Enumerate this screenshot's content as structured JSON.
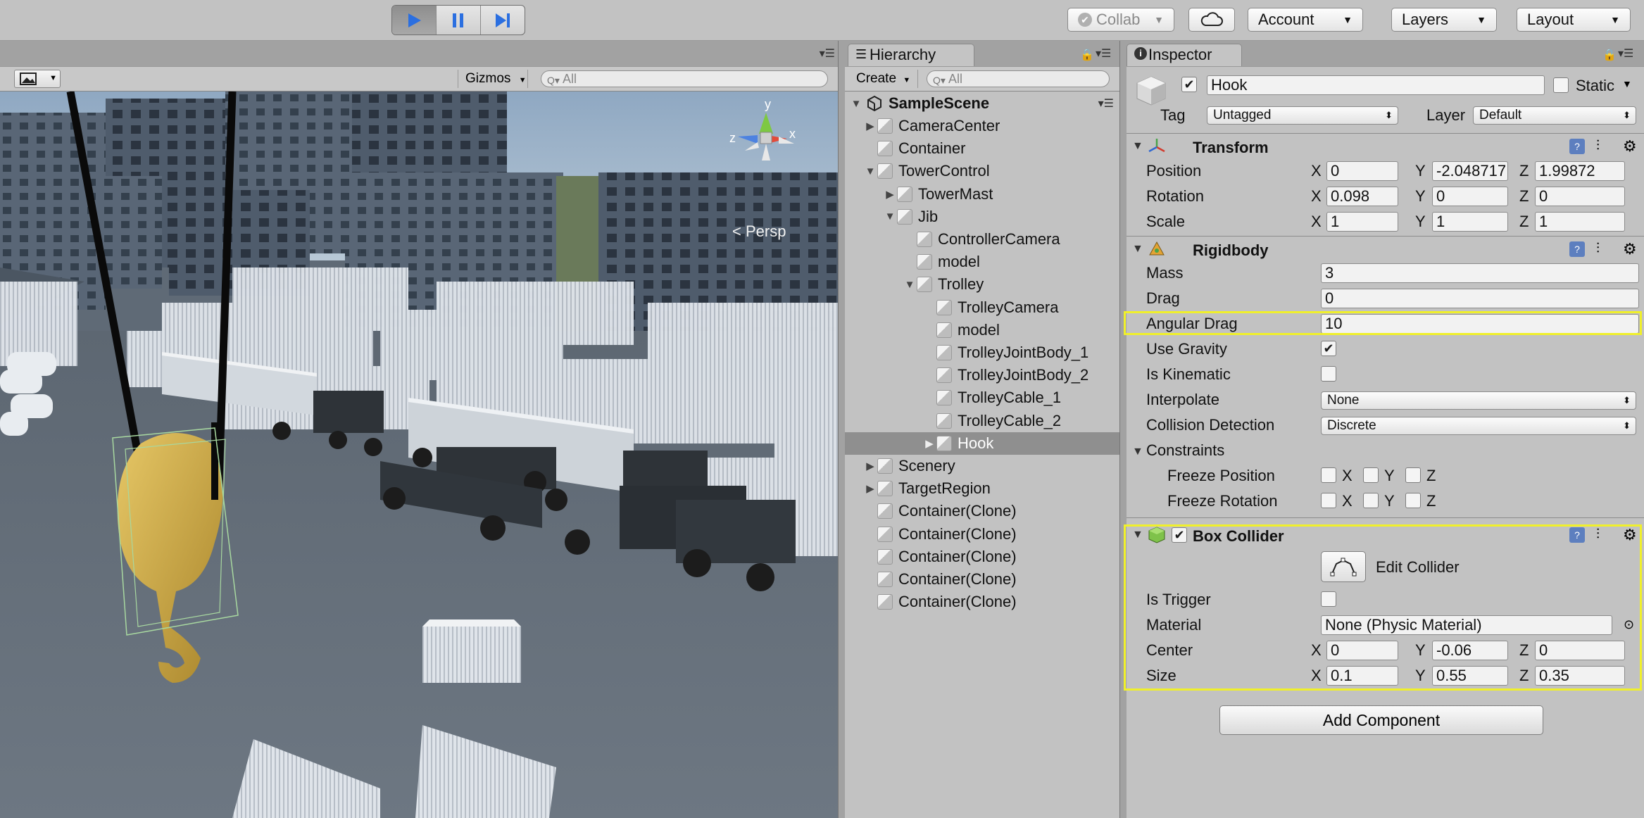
{
  "toolbar": {
    "collab_label": "Collab",
    "account_label": "Account",
    "layers_label": "Layers",
    "layout_label": "Layout"
  },
  "scene": {
    "gizmos_label": "Gizmos",
    "search_placeholder": "All",
    "persp_label": "Persp",
    "axis_x": "x",
    "axis_y": "y",
    "axis_z": "z"
  },
  "hierarchy": {
    "tab_label": "Hierarchy",
    "create_label": "Create",
    "search_placeholder": "All",
    "scene_name": "SampleScene",
    "items": [
      {
        "label": "CameraCenter",
        "depth": 1,
        "arrow": "right"
      },
      {
        "label": "Container",
        "depth": 1,
        "arrow": ""
      },
      {
        "label": "TowerControl",
        "depth": 1,
        "arrow": "down"
      },
      {
        "label": "TowerMast",
        "depth": 2,
        "arrow": "right"
      },
      {
        "label": "Jib",
        "depth": 2,
        "arrow": "down"
      },
      {
        "label": "ControllerCamera",
        "depth": 3,
        "arrow": ""
      },
      {
        "label": "model",
        "depth": 3,
        "arrow": ""
      },
      {
        "label": "Trolley",
        "depth": 3,
        "arrow": "down"
      },
      {
        "label": "TrolleyCamera",
        "depth": 4,
        "arrow": ""
      },
      {
        "label": "model",
        "depth": 4,
        "arrow": ""
      },
      {
        "label": "TrolleyJointBody_1",
        "depth": 4,
        "arrow": ""
      },
      {
        "label": "TrolleyJointBody_2",
        "depth": 4,
        "arrow": ""
      },
      {
        "label": "TrolleyCable_1",
        "depth": 4,
        "arrow": ""
      },
      {
        "label": "TrolleyCable_2",
        "depth": 4,
        "arrow": ""
      },
      {
        "label": "Hook",
        "depth": 4,
        "arrow": "right",
        "selected": true
      },
      {
        "label": "Scenery",
        "depth": 1,
        "arrow": "right"
      },
      {
        "label": "TargetRegion",
        "depth": 1,
        "arrow": "right"
      },
      {
        "label": "Container(Clone)",
        "depth": 1,
        "arrow": ""
      },
      {
        "label": "Container(Clone)",
        "depth": 1,
        "arrow": ""
      },
      {
        "label": "Container(Clone)",
        "depth": 1,
        "arrow": ""
      },
      {
        "label": "Container(Clone)",
        "depth": 1,
        "arrow": ""
      },
      {
        "label": "Container(Clone)",
        "depth": 1,
        "arrow": ""
      }
    ]
  },
  "inspector": {
    "tab_label": "Inspector",
    "object_name": "Hook",
    "static_label": "Static",
    "tag_label": "Tag",
    "tag_value": "Untagged",
    "layer_label": "Layer",
    "layer_value": "Default",
    "transform": {
      "title": "Transform",
      "position_label": "Position",
      "rotation_label": "Rotation",
      "scale_label": "Scale",
      "position": {
        "x": "0",
        "y": "-2.048717",
        "z": "1.99872"
      },
      "rotation": {
        "x": "0.098",
        "y": "0",
        "z": "0"
      },
      "scale": {
        "x": "1",
        "y": "1",
        "z": "1"
      }
    },
    "rigidbody": {
      "title": "Rigidbody",
      "mass_label": "Mass",
      "mass": "3",
      "drag_label": "Drag",
      "drag": "0",
      "angular_drag_label": "Angular Drag",
      "angular_drag": "10",
      "use_gravity_label": "Use Gravity",
      "is_kinematic_label": "Is Kinematic",
      "interpolate_label": "Interpolate",
      "interpolate": "None",
      "collision_label": "Collision Detection",
      "collision": "Discrete",
      "constraints_label": "Constraints",
      "freeze_position_label": "Freeze Position",
      "freeze_rotation_label": "Freeze Rotation"
    },
    "box_collider": {
      "title": "Box Collider",
      "edit_collider_label": "Edit Collider",
      "is_trigger_label": "Is Trigger",
      "material_label": "Material",
      "material": "None (Physic Material)",
      "center_label": "Center",
      "size_label": "Size",
      "center": {
        "x": "0",
        "y": "-0.06",
        "z": "0"
      },
      "size": {
        "x": "0.1",
        "y": "0.55",
        "z": "0.35"
      }
    },
    "axis_x": "X",
    "axis_y": "Y",
    "axis_z": "Z",
    "add_component_label": "Add Component"
  },
  "colors": {
    "highlight": "#f0f02a",
    "play_blue": "#2b6fe0",
    "selection": "#8f8f8f"
  }
}
